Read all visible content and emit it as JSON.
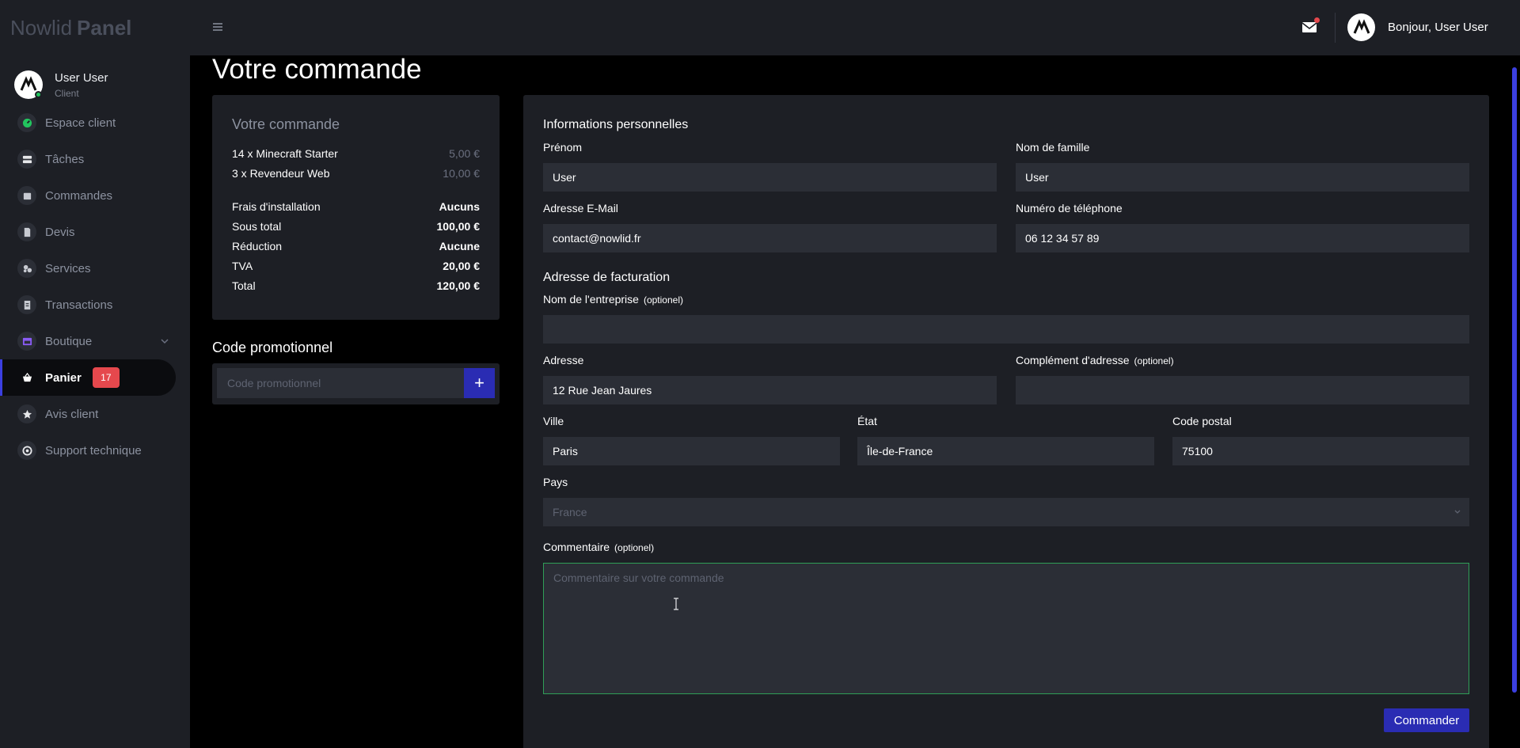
{
  "brand": {
    "part1": "Nowlid",
    "part2": "Panel"
  },
  "user": {
    "name": "User User",
    "role": "Client"
  },
  "sidebar": {
    "items": [
      {
        "label": "Espace client",
        "icon": "dashboard-icon"
      },
      {
        "label": "Tâches",
        "icon": "tasks-icon"
      },
      {
        "label": "Commandes",
        "icon": "orders-icon"
      },
      {
        "label": "Devis",
        "icon": "quote-icon"
      },
      {
        "label": "Services",
        "icon": "services-icon"
      },
      {
        "label": "Transactions",
        "icon": "transactions-icon"
      },
      {
        "label": "Boutique",
        "icon": "shop-icon"
      },
      {
        "label": "Panier",
        "icon": "cart-icon",
        "badge": "17"
      },
      {
        "label": "Avis client",
        "icon": "star-icon"
      },
      {
        "label": "Support technique",
        "icon": "support-icon"
      }
    ]
  },
  "topbar": {
    "greeting": "Bonjour, User User"
  },
  "page": {
    "title": "Votre commande"
  },
  "summary": {
    "title": "Votre commande",
    "items": [
      {
        "label": "14 x Minecraft Starter",
        "price": "5,00 €"
      },
      {
        "label": "3 x Revendeur Web",
        "price": "10,00 €"
      }
    ],
    "totals": [
      {
        "label": "Frais d'installation",
        "value": "Aucuns"
      },
      {
        "label": "Sous total",
        "value": "100,00 €"
      },
      {
        "label": "Réduction",
        "value": "Aucune"
      },
      {
        "label": "TVA",
        "value": "20,00 €"
      },
      {
        "label": "Total",
        "value": "120,00 €"
      }
    ]
  },
  "promo": {
    "title": "Code promotionnel",
    "placeholder": "Code promotionnel",
    "button": "+"
  },
  "form": {
    "personal_title": "Informations personnelles",
    "firstname": {
      "label": "Prénom",
      "value": "User"
    },
    "lastname": {
      "label": "Nom de famille",
      "value": "User"
    },
    "email": {
      "label": "Adresse E-Mail",
      "value": "contact@nowlid.fr"
    },
    "phone": {
      "label": "Numéro de téléphone",
      "value": "06 12 34 57 89"
    },
    "billing_title": "Adresse de facturation",
    "company": {
      "label": "Nom de l'entreprise",
      "optional": "(optionel)",
      "value": ""
    },
    "address": {
      "label": "Adresse",
      "value": "12 Rue Jean Jaures"
    },
    "address2": {
      "label": "Complément d'adresse",
      "optional": "(optionel)",
      "value": ""
    },
    "city": {
      "label": "Ville",
      "value": "Paris"
    },
    "state": {
      "label": "État",
      "value": "Île-de-France"
    },
    "zip": {
      "label": "Code postal",
      "value": "75100"
    },
    "country": {
      "label": "Pays",
      "value": "France"
    },
    "comment": {
      "label": "Commentaire",
      "optional": "(optionel)",
      "placeholder": "Commentaire sur votre commande"
    },
    "submit": "Commander"
  }
}
